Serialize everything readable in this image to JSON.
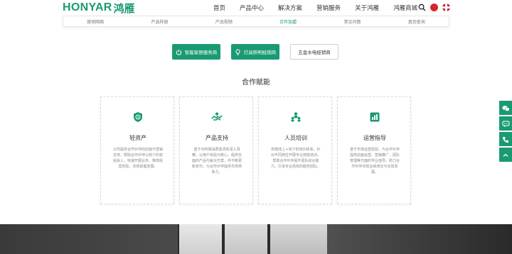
{
  "header": {
    "logo_latin": "HONYAR",
    "logo_cjk": "鸿雁",
    "nav": [
      "首页",
      "产品中心",
      "解决方案",
      "营销服务",
      "关于鸿雁",
      "鸿雁商城"
    ]
  },
  "subnav": {
    "items": [
      "营销网络",
      "产品样册",
      "产品视频",
      "合作加盟",
      "常见问题",
      "真伪查询"
    ],
    "active_index": 3
  },
  "categories": [
    {
      "label": "智能家居服务商",
      "icon": "power-icon",
      "style": "solid"
    },
    {
      "label": "灯具照明经销商",
      "icon": "lightbulb-icon",
      "style": "solid"
    },
    {
      "label": "五金水电经销商",
      "icon": "",
      "style": "outline"
    }
  ],
  "section_title": "合作赋能",
  "cards": [
    {
      "title": "轻资产",
      "icon": "shield-icon",
      "desc": "公司提供合作伙伴的店面与营销支持，帮助合作伙伴以较少的初始投入，快速开展业务，降低经营风险，实现稳健发展。"
    },
    {
      "title": "产品支持",
      "icon": "handshake-icon",
      "desc": "基于对终端消费需求的深入洞察，以用户体验为核心，提供全面的产品与解决方案，并不断更新迭代，为合作伙伴提供市场竞争力。"
    },
    {
      "title": "人员培训",
      "icon": "team-icon",
      "desc": "构建线上+线下的培训体系，针对不同岗位开展专业技能培训，帮助合作伙伴提升团队综合能力，打造专业高效的服务团队。"
    },
    {
      "title": "运营指导",
      "icon": "chart-icon",
      "desc": "基于市场运营经验，为合作伙伴提供店面运营、营销推广、团队管理等方面的专业指导，助力合作伙伴实现业绩增长与长效发展。"
    }
  ],
  "colors": {
    "brand": "#1a9a74",
    "band": "#2b2b2b"
  },
  "side_buttons": [
    "wechat-icon",
    "chat-icon",
    "phone-icon",
    "chevron-up-icon"
  ]
}
